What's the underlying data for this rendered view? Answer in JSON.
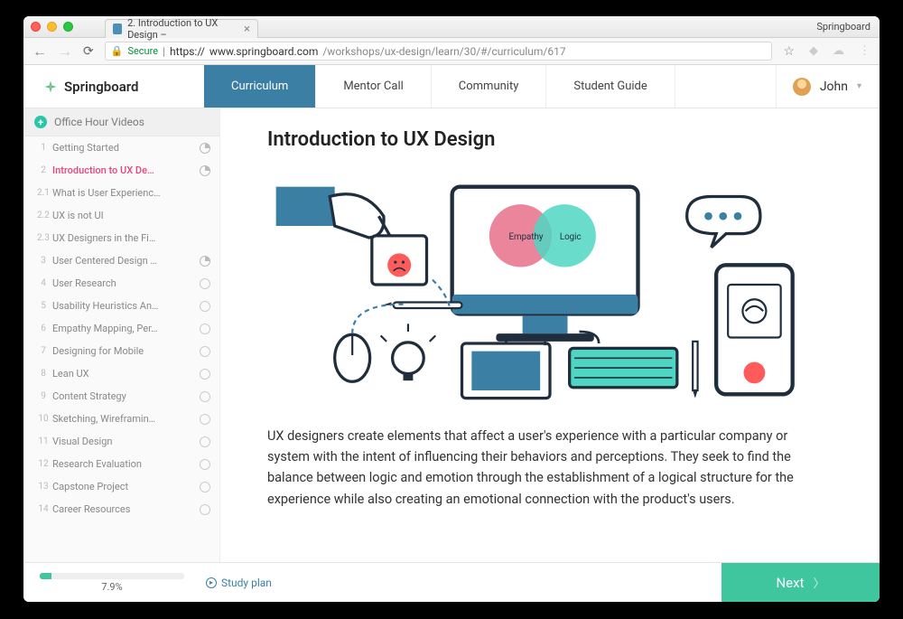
{
  "browser": {
    "app_name": "Springboard",
    "tab_title": "2. Introduction to UX Design – ",
    "secure_label": "Secure",
    "url_prefix": "https://",
    "url_host": "www.springboard.com",
    "url_path": "/workshops/ux-design/learn/30/#/curriculum/617"
  },
  "appnav": {
    "brand": "Springboard",
    "tabs": [
      "Curriculum",
      "Mentor Call",
      "Community",
      "Student Guide"
    ],
    "active_index": 0,
    "user_name": "John"
  },
  "sidebar": {
    "header": "Office Hour Videos",
    "items": [
      {
        "num": "1",
        "label": "Getting Started",
        "status": "clock"
      },
      {
        "num": "2",
        "label": "Introduction to UX De…",
        "status": "clock",
        "active": true
      },
      {
        "num": "2.1",
        "label": "What is User Experienc…",
        "status": ""
      },
      {
        "num": "2.2",
        "label": "UX is not UI",
        "status": ""
      },
      {
        "num": "2.3",
        "label": "UX Designers in the Fi…",
        "status": ""
      },
      {
        "num": "3",
        "label": "User Centered Design …",
        "status": "clock"
      },
      {
        "num": "4",
        "label": "User Research",
        "status": "empty"
      },
      {
        "num": "5",
        "label": "Usability Heuristics An…",
        "status": "empty"
      },
      {
        "num": "6",
        "label": "Empathy Mapping, Per…",
        "status": "empty"
      },
      {
        "num": "7",
        "label": "Designing for Mobile",
        "status": "empty"
      },
      {
        "num": "8",
        "label": "Lean UX",
        "status": "empty"
      },
      {
        "num": "9",
        "label": "Content Strategy",
        "status": "empty"
      },
      {
        "num": "10",
        "label": "Sketching, Wireframin…",
        "status": "empty"
      },
      {
        "num": "11",
        "label": "Visual Design",
        "status": "empty"
      },
      {
        "num": "12",
        "label": "Research Evaluation",
        "status": "empty"
      },
      {
        "num": "13",
        "label": "Capstone Project",
        "status": "empty"
      },
      {
        "num": "14",
        "label": "Career Resources",
        "status": "empty"
      }
    ]
  },
  "content": {
    "title": "Introduction to UX Design",
    "venn_left": "Empathy",
    "venn_right": "Logic",
    "paragraph": "UX designers create elements that affect a user's experience with a particular company or system with the intent of influencing their behaviors and perceptions. They seek to find the balance between logic and emotion through the establishment of a logical structure for the experience while also creating an emotional connection with the product's users."
  },
  "footer": {
    "progress_pct": "7.9%",
    "study_plan": "Study plan",
    "next": "Next"
  }
}
